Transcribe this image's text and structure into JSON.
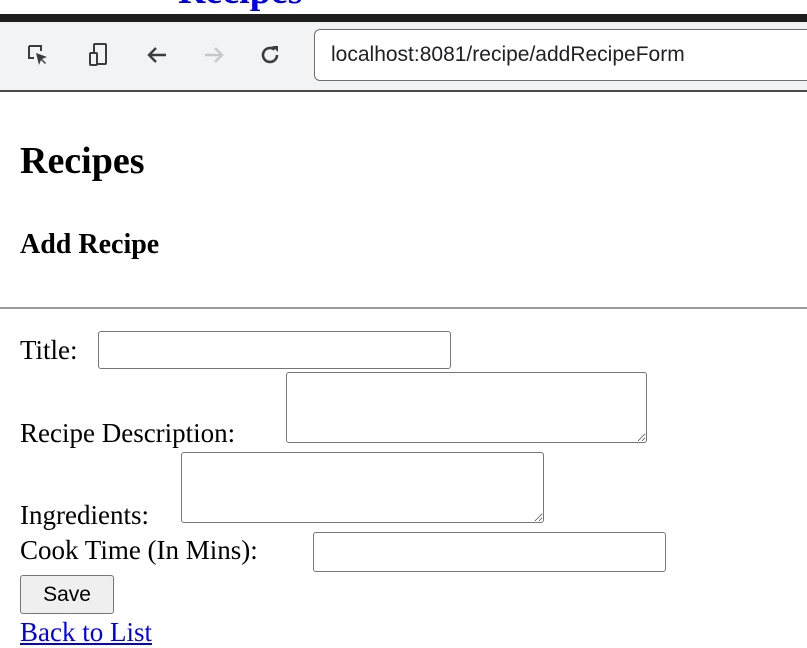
{
  "page": {
    "cut_heading": "Recipes"
  },
  "browser": {
    "url": "localhost:8081/recipe/addRecipeForm",
    "icons": {
      "inspect": "inspect-element-icon",
      "device": "device-toolbar-icon",
      "back": "back-arrow-icon",
      "forward": "forward-arrow-icon",
      "reload": "reload-icon"
    }
  },
  "main": {
    "title": "Recipes",
    "subtitle": "Add Recipe",
    "form": {
      "title_label": "Title:",
      "title_value": "",
      "description_label": "Recipe Description:",
      "description_value": "",
      "ingredients_label": "Ingredients:",
      "ingredients_value": "",
      "cook_time_label": "Cook Time (In Mins):",
      "cook_time_value": "",
      "save_label": "Save"
    },
    "back_link": "Back to List"
  },
  "colors": {
    "link": "#0000ee",
    "toolbar_bg": "#f1f3f4",
    "top_bar": "#1e1e1e"
  }
}
